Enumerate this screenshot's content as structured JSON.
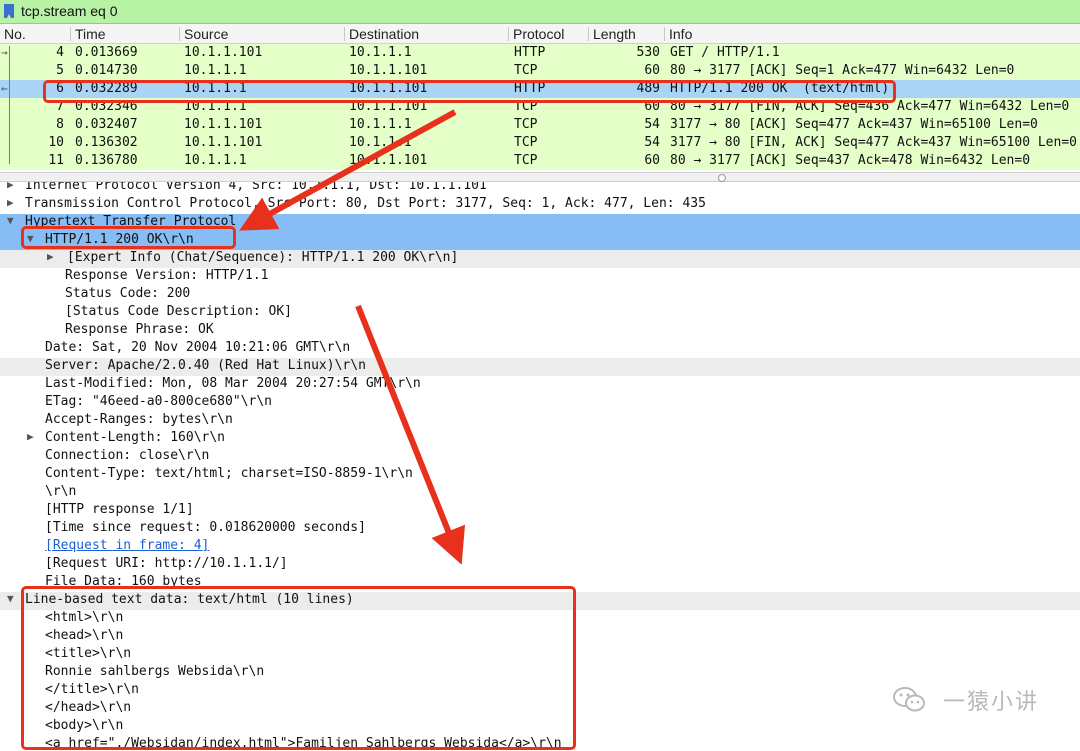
{
  "filter": {
    "value": "tcp.stream eq 0"
  },
  "columns": [
    "No.",
    "Time",
    "Source",
    "Destination",
    "Protocol",
    "Length",
    "Info"
  ],
  "packets": [
    {
      "no": "4",
      "time": "0.013669",
      "src": "10.1.1.101",
      "dst": "10.1.1.1",
      "proto": "HTTP",
      "len": "530",
      "info": "GET / HTTP/1.1"
    },
    {
      "no": "5",
      "time": "0.014730",
      "src": "10.1.1.1",
      "dst": "10.1.1.101",
      "proto": "TCP",
      "len": "60",
      "info": "80 → 3177 [ACK] Seq=1 Ack=477 Win=6432 Len=0"
    },
    {
      "no": "6",
      "time": "0.032289",
      "src": "10.1.1.1",
      "dst": "10.1.1.101",
      "proto": "HTTP",
      "len": "489",
      "info": "HTTP/1.1 200 OK  (text/html)",
      "selected": true
    },
    {
      "no": "7",
      "time": "0.032346",
      "src": "10.1.1.1",
      "dst": "10.1.1.101",
      "proto": "TCP",
      "len": "60",
      "info": "80 → 3177 [FIN, ACK] Seq=436 Ack=477 Win=6432 Len=0"
    },
    {
      "no": "8",
      "time": "0.032407",
      "src": "10.1.1.101",
      "dst": "10.1.1.1",
      "proto": "TCP",
      "len": "54",
      "info": "3177 → 80 [ACK] Seq=477 Ack=437 Win=65100 Len=0"
    },
    {
      "no": "10",
      "time": "0.136302",
      "src": "10.1.1.101",
      "dst": "10.1.1.1",
      "proto": "TCP",
      "len": "54",
      "info": "3177 → 80 [FIN, ACK] Seq=477 Ack=437 Win=65100 Len=0"
    },
    {
      "no": "11",
      "time": "0.136780",
      "src": "10.1.1.1",
      "dst": "10.1.1.101",
      "proto": "TCP",
      "len": "60",
      "info": "80 → 3177 [ACK] Seq=437 Ack=478 Win=6432 Len=0"
    }
  ],
  "details": [
    {
      "text": "Internet Protocol Version 4, Src: 10.1.1.1, Dst: 10.1.1.101",
      "tri": "▶",
      "indent": 0
    },
    {
      "text": "Transmission Control Protocol, Src Port: 80, Dst Port: 3177, Seq: 1, Ack: 477, Len: 435",
      "tri": "▶",
      "indent": 0
    },
    {
      "text": "Hypertext Transfer Protocol",
      "tri": "▼",
      "indent": 0,
      "style": "hl"
    },
    {
      "text": "HTTP/1.1 200 OK\\r\\n",
      "tri": "▼",
      "indent": 1,
      "style": "hl"
    },
    {
      "text": "[Expert Info (Chat/Sequence): HTTP/1.1 200 OK\\r\\n]",
      "tri": "▶",
      "indent": 2,
      "style": "gray"
    },
    {
      "text": "Response Version: HTTP/1.1",
      "indent": 3
    },
    {
      "text": "Status Code: 200",
      "indent": 3
    },
    {
      "text": "[Status Code Description: OK]",
      "indent": 3
    },
    {
      "text": "Response Phrase: OK",
      "indent": 3
    },
    {
      "text": "Date: Sat, 20 Nov 2004 10:21:06 GMT\\r\\n",
      "indent": 1
    },
    {
      "text": "Server: Apache/2.0.40 (Red Hat Linux)\\r\\n",
      "indent": 1,
      "style": "gray"
    },
    {
      "text": "Last-Modified: Mon, 08 Mar 2004 20:27:54 GMT\\r\\n",
      "indent": 1
    },
    {
      "text": "ETag: \"46eed-a0-800ce680\"\\r\\n",
      "indent": 1
    },
    {
      "text": "Accept-Ranges: bytes\\r\\n",
      "indent": 1
    },
    {
      "text": "Content-Length: 160\\r\\n",
      "tri": "▶",
      "indent": 1
    },
    {
      "text": "Connection: close\\r\\n",
      "indent": 1
    },
    {
      "text": "Content-Type: text/html; charset=ISO-8859-1\\r\\n",
      "indent": 1
    },
    {
      "text": "\\r\\n",
      "indent": 1
    },
    {
      "text": "[HTTP response 1/1]",
      "indent": 1
    },
    {
      "text": "[Time since request: 0.018620000 seconds]",
      "indent": 1
    },
    {
      "text": "[Request in frame: 4]",
      "indent": 1,
      "link": true
    },
    {
      "text": "[Request URI: http://10.1.1.1/]",
      "indent": 1
    },
    {
      "text": "File Data: 160 bytes",
      "indent": 1
    },
    {
      "text": "Line-based text data: text/html (10 lines)",
      "tri": "▼",
      "indent": 0,
      "style": "gray"
    },
    {
      "text": "<html>\\r\\n",
      "indent": 1
    },
    {
      "text": "<head>\\r\\n",
      "indent": 1
    },
    {
      "text": "<title>\\r\\n",
      "indent": 1
    },
    {
      "text": "Ronnie sahlbergs Websida\\r\\n",
      "indent": 1
    },
    {
      "text": "</title>\\r\\n",
      "indent": 1
    },
    {
      "text": "</head>\\r\\n",
      "indent": 1
    },
    {
      "text": "<body>\\r\\n",
      "indent": 1
    },
    {
      "text": "<a href=\"./Websidan/index.html\">Familjen Sahlbergs Websida</a>\\r\\n",
      "indent": 1
    }
  ],
  "watermark": {
    "text": "一猿小讲",
    "icon": "wechat-icon"
  },
  "colors": {
    "filter_bg": "#b7f2a5",
    "packet_bg": "#e4ffc7",
    "selected_bg": "#a9d4f5",
    "highlight_bg": "#86bdf5",
    "annotation_red": "#e8311c"
  }
}
